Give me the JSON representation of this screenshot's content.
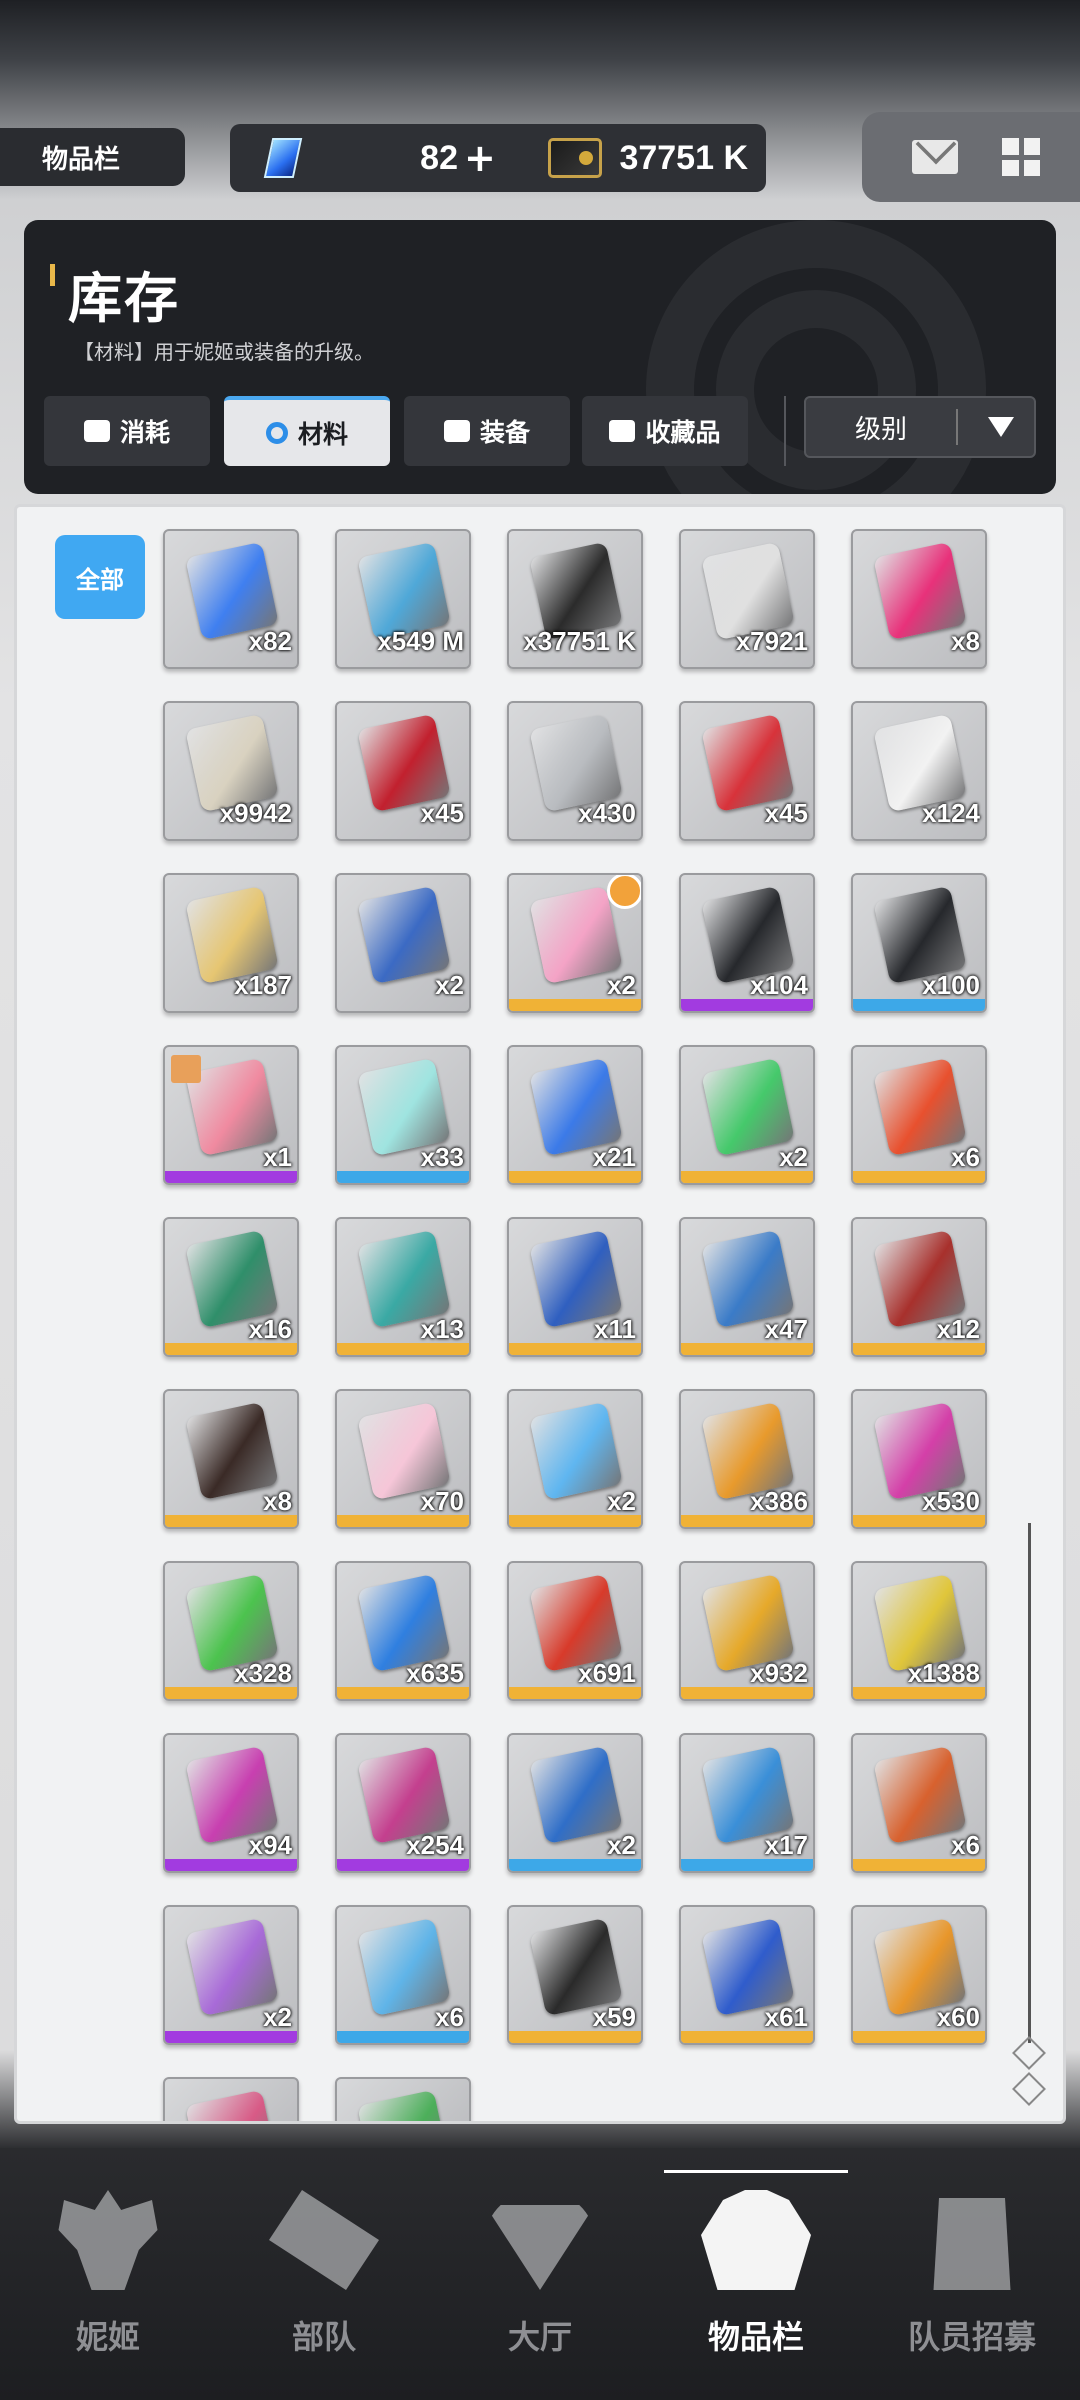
{
  "header": {
    "section_tab": "物品栏",
    "gems": "82",
    "gems_plus": "+",
    "credits": "37751 K",
    "gem_icon": "gem-icon",
    "credit_icon": "credit-card-icon"
  },
  "top_right": {
    "mail_icon": "mail-icon",
    "menu_icon": "grid-menu-icon"
  },
  "panel": {
    "title": "库存",
    "description": "【材料】用于妮姬或装备的升级。",
    "tabs": [
      {
        "label": "消耗",
        "icon": "consumable-icon"
      },
      {
        "label": "材料",
        "icon": "material-icon"
      },
      {
        "label": "装备",
        "icon": "equipment-icon"
      },
      {
        "label": "收藏品",
        "icon": "collection-icon"
      }
    ],
    "active_tab": "材料",
    "sort_label": "级别"
  },
  "filter": {
    "all_label": "全部"
  },
  "colors": {
    "accent": "#40a8f2",
    "gold": "#f0b236",
    "purple": "#a23be0",
    "blue": "#3da8e8"
  },
  "items": [
    {
      "count": "x82",
      "art": "#3f7ff0",
      "rarity": "none"
    },
    {
      "count": "x549 M",
      "art": "#4fa8d8",
      "rarity": "none"
    },
    {
      "count": "x37751 K",
      "art": "#2b2b2b",
      "rarity": "none"
    },
    {
      "count": "x7921",
      "art": "#e0e0e0",
      "rarity": "none"
    },
    {
      "count": "x8",
      "art": "#e8317a",
      "rarity": "none"
    },
    {
      "count": "x9942",
      "art": "#d9d2c0",
      "rarity": "none"
    },
    {
      "count": "x45",
      "art": "#c2202e",
      "rarity": "none"
    },
    {
      "count": "x430",
      "art": "#b9bcc0",
      "rarity": "none"
    },
    {
      "count": "x45",
      "art": "#d8323a",
      "rarity": "none"
    },
    {
      "count": "x124",
      "art": "#f2f2f2",
      "rarity": "none"
    },
    {
      "count": "x187",
      "art": "#e6c672",
      "rarity": "none"
    },
    {
      "count": "x2",
      "art": "#3b6ac4",
      "rarity": "none"
    },
    {
      "count": "x2",
      "art": "#f4a3c6",
      "rarity": "gold",
      "badge": "clock-badge-icon"
    },
    {
      "count": "x104",
      "art": "#26282c",
      "rarity": "purple"
    },
    {
      "count": "x100",
      "art": "#26282c",
      "rarity": "blue"
    },
    {
      "count": "x1",
      "art": "#f08aa0",
      "rarity": "purple",
      "gift": "gift-icon"
    },
    {
      "count": "x33",
      "art": "#9fe4e0",
      "rarity": "blue"
    },
    {
      "count": "x21",
      "art": "#3b7ae8",
      "rarity": "gold"
    },
    {
      "count": "x2",
      "art": "#45c96b",
      "rarity": "gold"
    },
    {
      "count": "x6",
      "art": "#e8502e",
      "rarity": "gold"
    },
    {
      "count": "x16",
      "art": "#2f8f6a",
      "rarity": "gold"
    },
    {
      "count": "x13",
      "art": "#3aa9a4",
      "rarity": "gold"
    },
    {
      "count": "x11",
      "art": "#2f5fc0",
      "rarity": "gold"
    },
    {
      "count": "x47",
      "art": "#3a7bc8",
      "rarity": "gold"
    },
    {
      "count": "x12",
      "art": "#a8302c",
      "rarity": "gold"
    },
    {
      "count": "x8",
      "art": "#3a2a26",
      "rarity": "gold"
    },
    {
      "count": "x70",
      "art": "#f6c6d8",
      "rarity": "gold"
    },
    {
      "count": "x2",
      "art": "#5fb6f0",
      "rarity": "gold"
    },
    {
      "count": "x386",
      "art": "#e89a2c",
      "rarity": "gold"
    },
    {
      "count": "x530",
      "art": "#d43fa8",
      "rarity": "gold"
    },
    {
      "count": "x328",
      "art": "#4cc34e",
      "rarity": "gold"
    },
    {
      "count": "x635",
      "art": "#2f7fe0",
      "rarity": "gold"
    },
    {
      "count": "x691",
      "art": "#d83a2a",
      "rarity": "gold"
    },
    {
      "count": "x932",
      "art": "#e6a92a",
      "rarity": "gold"
    },
    {
      "count": "x1388",
      "art": "#e0c63a",
      "rarity": "gold"
    },
    {
      "count": "x94",
      "art": "#c83fb0",
      "rarity": "purple"
    },
    {
      "count": "x254",
      "art": "#c43f8e",
      "rarity": "purple"
    },
    {
      "count": "x2",
      "art": "#2f6ec8",
      "rarity": "blue"
    },
    {
      "count": "x17",
      "art": "#3a8fd8",
      "rarity": "blue"
    },
    {
      "count": "x6",
      "art": "#d8612e",
      "rarity": "gold"
    },
    {
      "count": "x2",
      "art": "#a86ad8",
      "rarity": "purple"
    },
    {
      "count": "x6",
      "art": "#5fb4e8",
      "rarity": "blue"
    },
    {
      "count": "x59",
      "art": "#2a2a2a",
      "rarity": "gold"
    },
    {
      "count": "x61",
      "art": "#2f5ccc",
      "rarity": "gold"
    },
    {
      "count": "x60",
      "art": "#e8962a",
      "rarity": "gold"
    },
    {
      "count": "",
      "art": "#d85a86",
      "rarity": "none"
    },
    {
      "count": "",
      "art": "#4caf5a",
      "rarity": "none"
    }
  ],
  "nav": [
    {
      "label": "妮姬",
      "icon": "nikke-icon"
    },
    {
      "label": "部队",
      "icon": "squad-icon"
    },
    {
      "label": "大厅",
      "icon": "lobby-icon"
    },
    {
      "label": "物品栏",
      "icon": "inventory-icon"
    },
    {
      "label": "队员招募",
      "icon": "recruit-icon"
    }
  ],
  "nav_active": "物品栏"
}
